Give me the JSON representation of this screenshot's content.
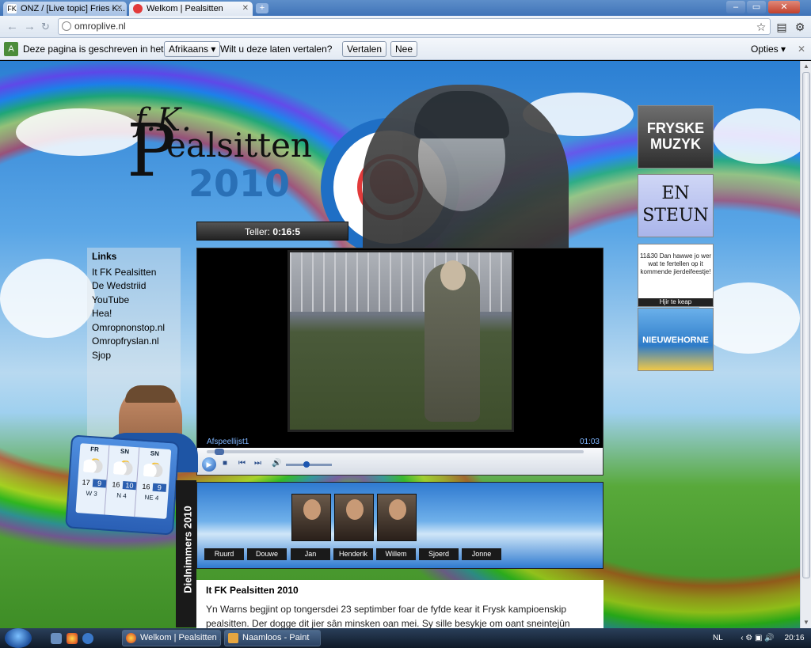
{
  "browser": {
    "tabs": [
      {
        "label": "ONZ / [Live topic] Fries K...",
        "fav": "FK"
      },
      {
        "label": "Welkom | Pealsitten",
        "fav": ""
      }
    ],
    "newtab_label": "+",
    "address": "omroplive.nl",
    "translate_bar": {
      "text1": "Deze pagina is geschreven in het",
      "language": "Afrikaans ▾",
      "text2": "Wilt u deze laten vertalen?",
      "translate_button": "Vertalen",
      "no_button": "Nee",
      "options": "Opties ▾"
    }
  },
  "site": {
    "logo_fk": "f.K.",
    "logo_p": "P",
    "logo_name": "ealsitten",
    "logo_year": "2010",
    "teller_label": "Teller:",
    "teller_value": "0:16:5",
    "player": {
      "playlist": "Afspeellijst1",
      "duration": "01:03"
    },
    "links": {
      "title": "Links",
      "items": [
        "It FK Pealsitten",
        "De Wedstriid",
        "YouTube",
        "Hea!",
        "Omropnonstop.nl",
        "Omropfryslan.nl",
        "Sjop"
      ]
    },
    "weather": [
      {
        "day": "FR",
        "hi": "17",
        "lo": "9",
        "wind": "W 3"
      },
      {
        "day": "SN",
        "hi": "16",
        "lo": "10",
        "wind": "N 4"
      },
      {
        "day": "SN",
        "hi": "16",
        "lo": "9",
        "wind": "NE 4"
      }
    ],
    "ads": {
      "ad1": "FRYSKE MUZYK",
      "ad2": "EN STEUN",
      "ad3_text": "11&30 Dan hawwe jo wer wat te fertellen op it kommende jierdeifeestje!",
      "ad3_bar": "Hjir te keap",
      "ad4": "NIEUWEHORNE"
    },
    "side_label": "Dielnimmers 2010",
    "team": [
      "Ruurd",
      "Douwe",
      "Jan",
      "Henderik",
      "Willem",
      "Sjoerd",
      "Jonne"
    ],
    "article": {
      "title": "It FK Pealsitten 2010",
      "body": "Yn Warns begjint op tongersdei 23 septimber foar de fyfde kear it Frysk kampioenskip pealsitten. Der dogge dit jier sân minsken oan mei. Sy sille besykje om oant sneintejûn 20.00 oere sitten te"
    }
  },
  "taskbar": {
    "tasks": [
      "Welkom | Pealsitten ...",
      "Naamloos - Paint"
    ],
    "lang": "NL",
    "time": "20:16"
  },
  "colors": {
    "accent": "#1f6fc5",
    "translate_underline": "#d12a2a"
  }
}
